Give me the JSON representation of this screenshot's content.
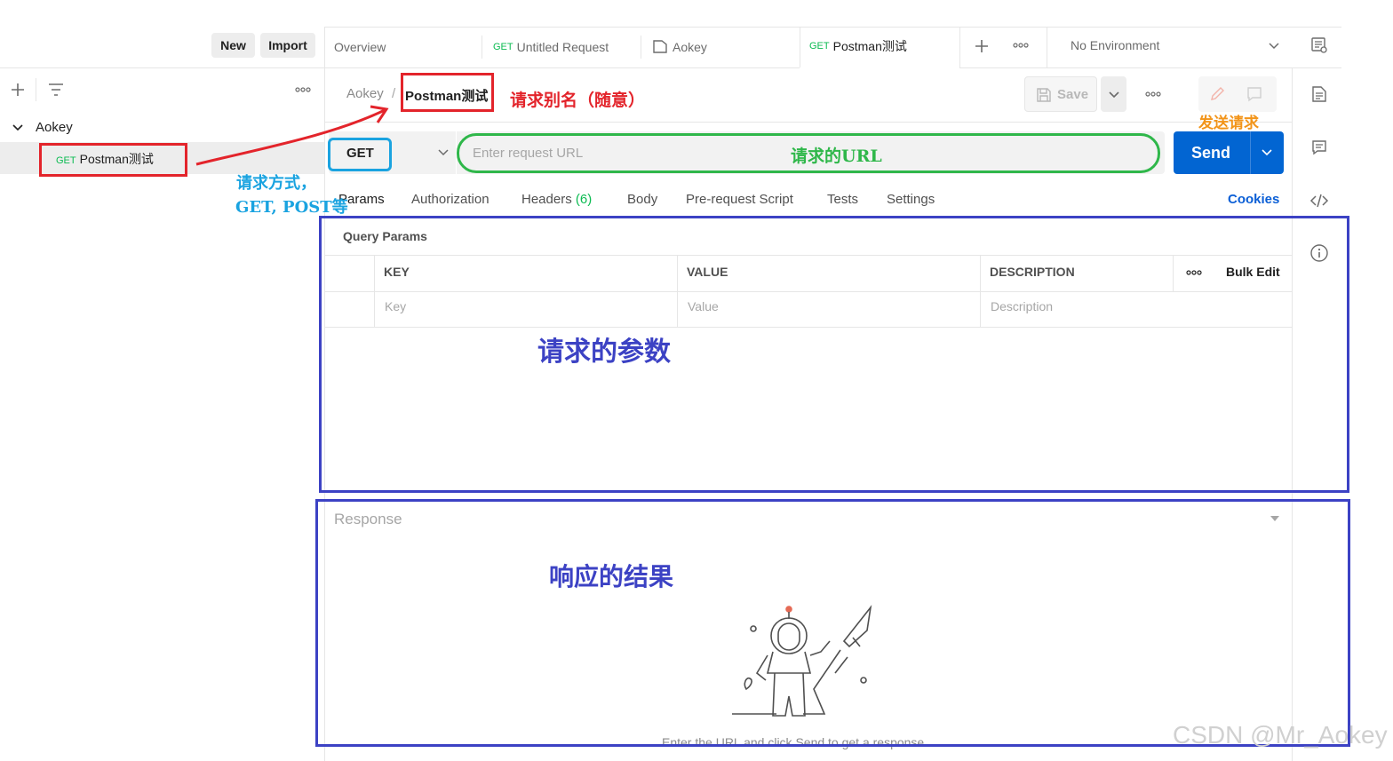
{
  "sidebar": {
    "new_label": "New",
    "import_label": "Import",
    "collection_name": "Aokey",
    "request_method": "GET",
    "request_name": "Postman测试"
  },
  "tabs": [
    {
      "label": "Overview"
    },
    {
      "method": "GET",
      "label": "Untitled Request"
    },
    {
      "label": "Aokey"
    },
    {
      "method": "GET",
      "label": "Postman测试"
    }
  ],
  "environment": {
    "label": "No Environment"
  },
  "request": {
    "breadcrumb_parent": "Aokey",
    "breadcrumb_sep": "/",
    "name": "Postman测试",
    "save_label": "Save",
    "method": "GET",
    "url_placeholder": "Enter request URL",
    "send_label": "Send",
    "tabs": [
      "Params",
      "Authorization",
      "Headers",
      "Body",
      "Pre-request Script",
      "Tests",
      "Settings"
    ],
    "headers_count": "(6)",
    "cookies_label": "Cookies"
  },
  "params": {
    "section_title": "Query Params",
    "columns": [
      "KEY",
      "VALUE",
      "DESCRIPTION"
    ],
    "bulk_edit_label": "Bulk Edit",
    "placeholders": [
      "Key",
      "Value",
      "Description"
    ]
  },
  "response": {
    "title": "Response",
    "hint": "Enter the URL and click Send to get a response"
  },
  "annotations": {
    "alias": "请求别名（随意）",
    "send": "发送请求",
    "method_line1": "请求方式，",
    "method_line2": "GET, POST等",
    "url": "请求的URL",
    "params": "请求的参数",
    "response": "响应的结果"
  },
  "watermark": "CSDN @Mr_Aokey",
  "colors": {
    "send_blue": "#0265d2",
    "get_green": "#0cbb52",
    "cookies_blue": "#0b5fd6",
    "annot_red": "#e3242b",
    "annot_blue": "#3c42c4",
    "annot_cyan": "#1aa3e0",
    "annot_green": "#2fb74a",
    "annot_orange": "#f29419"
  }
}
